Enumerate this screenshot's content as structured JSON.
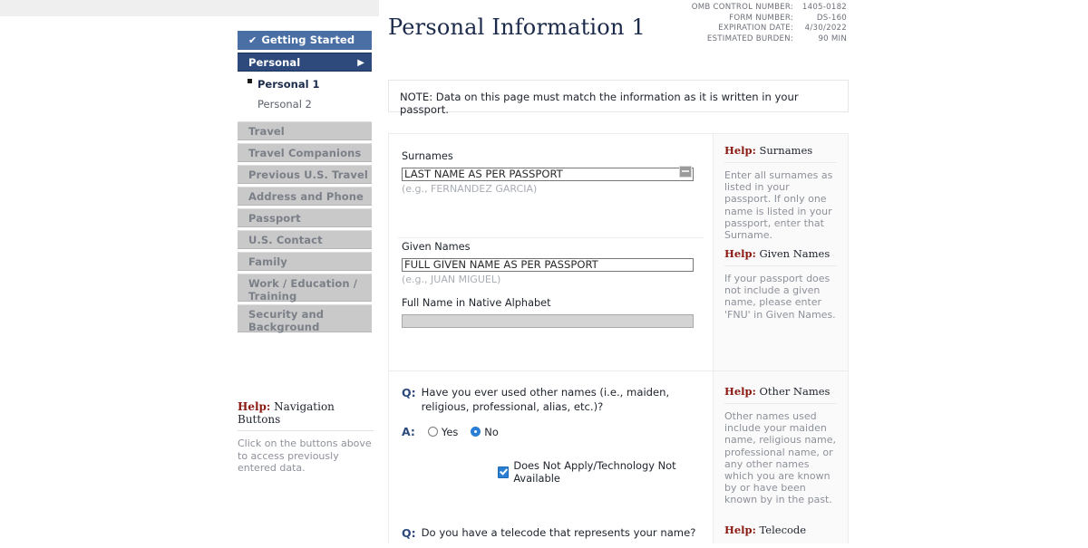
{
  "header": {
    "title": "Personal Information 1",
    "omb": [
      {
        "label": "OMB CONTROL NUMBER:",
        "value": "1405-0182"
      },
      {
        "label": "FORM NUMBER:",
        "value": "DS-160"
      },
      {
        "label": "EXPIRATION DATE:",
        "value": "4/30/2022"
      },
      {
        "label": "ESTIMATED BURDEN:",
        "value": "90 MIN"
      }
    ]
  },
  "note": {
    "text": "NOTE: Data on this page must match the information as it is written in your passport."
  },
  "sidebar": {
    "items": [
      {
        "label": "Getting Started",
        "state": "completed",
        "check": "✔"
      },
      {
        "label": "Personal",
        "state": "current",
        "arrow": "▶"
      },
      {
        "label": "Personal 1",
        "state": "sub-active"
      },
      {
        "label": "Personal 2",
        "state": "sub-plain"
      },
      {
        "label": "Travel",
        "state": "disabled"
      },
      {
        "label": "Travel Companions",
        "state": "disabled"
      },
      {
        "label": "Previous U.S. Travel",
        "state": "disabled"
      },
      {
        "label": "Address and Phone",
        "state": "disabled"
      },
      {
        "label": "Passport",
        "state": "disabled"
      },
      {
        "label": "U.S. Contact",
        "state": "disabled"
      },
      {
        "label": "Family",
        "state": "disabled"
      },
      {
        "label": "Work / Education / Training",
        "state": "disabled"
      },
      {
        "label": "Security and Background",
        "state": "disabled"
      }
    ],
    "nav_help": {
      "help_word": "Help:",
      "topic": " Navigation Buttons",
      "body": "Click on the buttons above to access previously entered data."
    }
  },
  "form": {
    "surnames": {
      "label": "Surnames",
      "value": "LAST NAME AS PER PASSPORT",
      "placeholder": "",
      "hint": "(e.g., FERNANDEZ GARCIA)"
    },
    "given_names": {
      "label": "Given Names",
      "value": "FULL GIVEN NAME AS PER PASSPORT",
      "placeholder": "",
      "hint": "(e.g., JUAN MIGUEL)"
    },
    "native_alphabet": {
      "label": "Full Name in Native Alphabet",
      "value": "",
      "placeholder": "",
      "checkbox_label": "Does Not Apply/Technology Not Available",
      "checked": true
    },
    "questions": [
      {
        "q_mark": "Q:",
        "a_mark": "A:",
        "text": "Have you ever used other names (i.e., maiden, religious, professional, alias, etc.)?",
        "options": [
          {
            "label": "Yes",
            "selected": false
          },
          {
            "label": "No",
            "selected": true
          }
        ]
      },
      {
        "q_mark": "Q:",
        "text": "Do you have a telecode that represents your name?"
      }
    ]
  },
  "help_panel": {
    "blocks": [
      {
        "help_word": "Help:",
        "topic": " Surnames",
        "body": "Enter all surnames as listed in your passport. If only one name is listed in your passport, enter that Surname."
      },
      {
        "help_word": "Help:",
        "topic": " Given Names",
        "body": "If your passport does not include a given name, please enter 'FNU' in Given Names."
      },
      {
        "help_word": "Help:",
        "topic": " Other Names",
        "body": "Other names used include your maiden name, religious name, professional name, or any other names which you are known by or have been known by in the past."
      },
      {
        "help_word": "Help:",
        "topic": " Telecode",
        "body": ""
      }
    ]
  },
  "colors": {
    "nav_completed": "#4a6fa5",
    "nav_current": "#2e4a7d",
    "nav_disabled": "#c9c9c9",
    "help_accent": "#8b1a12",
    "accent_blue": "#2a7fd4",
    "title": "#1b2a4a"
  }
}
